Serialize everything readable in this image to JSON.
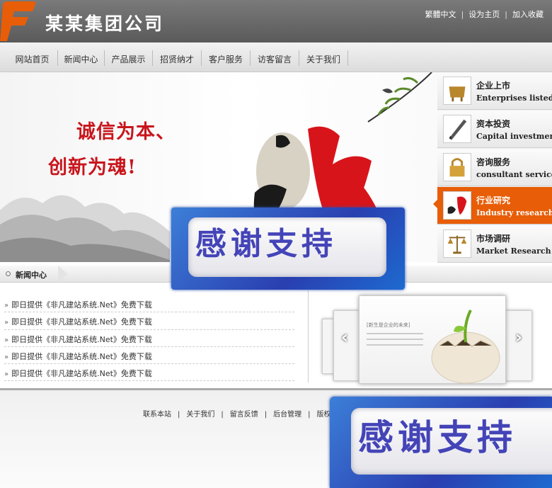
{
  "header": {
    "title": "某某集团公司",
    "links": [
      "繁體中文",
      "设为主页",
      "加入收藏"
    ]
  },
  "nav": {
    "items": [
      "网站首页",
      "新闻中心",
      "产品展示",
      "招贤纳才",
      "客户服务",
      "访客留言",
      "关于我们"
    ]
  },
  "banner": {
    "slogan_line1": "诚信为本、",
    "slogan_line2": "创新为魂!"
  },
  "sidebar": {
    "items": [
      {
        "zh": "企业上市",
        "en": "Enterprises listed",
        "active": false
      },
      {
        "zh": "资本投资",
        "en": "Capital investment",
        "active": false
      },
      {
        "zh": "咨询服务",
        "en": "consultant service",
        "active": false
      },
      {
        "zh": "行业研究",
        "en": "Industry research",
        "active": true
      },
      {
        "zh": "市场调研",
        "en": "Market Research",
        "active": false
      }
    ]
  },
  "news": {
    "tab_label": "新闻中心",
    "items": [
      "即日提供《非凡建站系统.Net》免费下载",
      "即日提供《非凡建站系统.Net》免费下载",
      "即日提供《非凡建站系统.Net》免费下载",
      "即日提供《非凡建站系统.Net》免费下载",
      "即日提供《非凡建站系统.Net》免费下载"
    ]
  },
  "carousel": {
    "caption": "[新生是企业的未来]",
    "prev_glyph": "‹",
    "next_glyph": "›"
  },
  "footer": {
    "links": [
      "联系本站",
      "关于我们",
      "留言反馈",
      "后台管理",
      "版权"
    ]
  },
  "watermark": {
    "text": "感谢支持"
  },
  "colors": {
    "accent": "#e85d07",
    "slogan_red": "#c8161d",
    "header_gray": "#6a6a6a",
    "watermark_blue": "#2a3fb0"
  }
}
